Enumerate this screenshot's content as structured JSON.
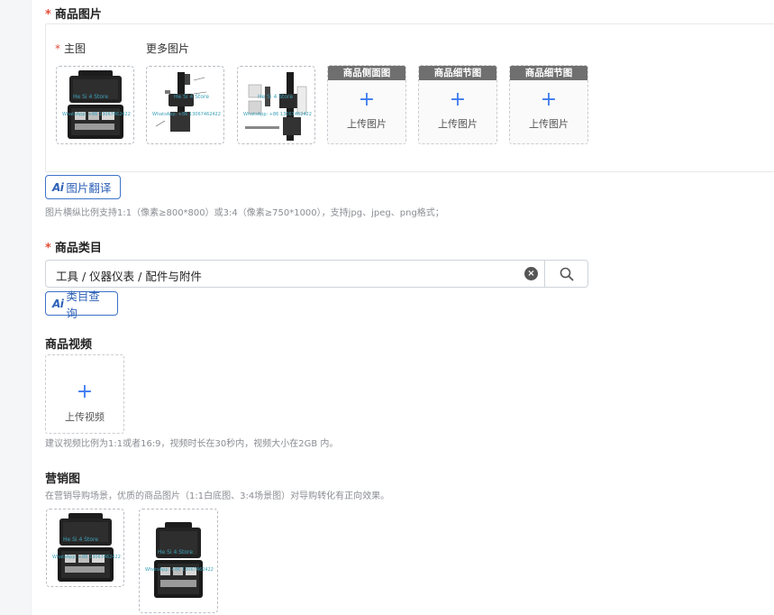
{
  "images_section": {
    "title": "商品图片",
    "main_label": "主图",
    "more_label": "更多图片",
    "slots": [
      {
        "head": "商品侧面图",
        "upload": "上传图片"
      },
      {
        "head": "商品细节图",
        "upload": "上传图片"
      },
      {
        "head": "商品细节图",
        "upload": "上传图片"
      }
    ],
    "ai_translate_label": "图片翻译",
    "hint": "图片横纵比例支持1:1（像素≥800*800）或3:4（像素≥750*1000），支持jpg、jpeg、png格式；"
  },
  "category_section": {
    "title": "商品类目",
    "value": "工具 / 仪器仪表 / 配件与附件",
    "ai_query_label": "类目查询"
  },
  "video_section": {
    "title": "商品视频",
    "upload": "上传视频",
    "hint": "建议视频比例为1:1或者16:9，视频时长在30秒内，视频大小在2GB 内。"
  },
  "marketing_section": {
    "title": "营销图",
    "hint": "在营销导购场景，优质的商品图片（1:1白底图、3:4场景图）对导购转化有正向效果。"
  },
  "ai_badge": "Ai",
  "product_image_text": {
    "brand": "He  Si  4  Store",
    "contact": "WhatsApp: +86 13067462422"
  },
  "icons": {
    "plus": "plus-icon",
    "clear": "clear-circle-icon",
    "search": "search-icon"
  },
  "colors": {
    "accent": "#3d7bf0",
    "ai_border": "#3d72c9",
    "required": "#e34d3a",
    "slot_header": "#6f6f6f"
  }
}
